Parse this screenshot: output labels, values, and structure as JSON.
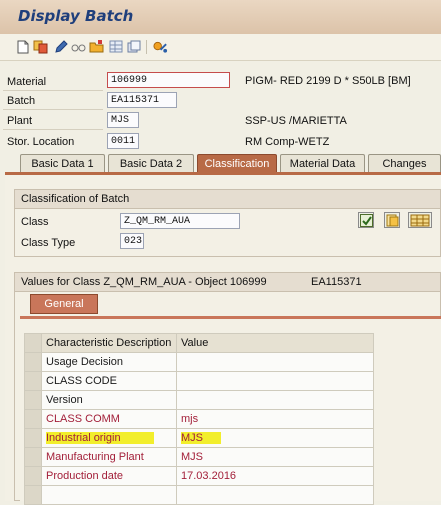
{
  "window": {
    "title": "Display Batch"
  },
  "toolbar": {
    "icons": [
      "new-document-icon",
      "copy-icon",
      "edit-pencil-icon",
      "glasses-icon",
      "folder-icon",
      "grid-icon",
      "layers-icon"
    ]
  },
  "header": {
    "material": {
      "label": "Material",
      "value": "106999",
      "description": "PIGM- RED 2199 D * S50LB [BM]"
    },
    "batch": {
      "label": "Batch",
      "value": "EA115371"
    },
    "plant": {
      "label": "Plant",
      "value": "MJS",
      "description": "SSP-US   /MARIETTA"
    },
    "stor_location": {
      "label": "Stor. Location",
      "value": "0011",
      "description": "RM Comp-WETZ"
    }
  },
  "tabs": [
    {
      "label": "Basic Data 1",
      "active": false
    },
    {
      "label": "Basic Data 2",
      "active": false
    },
    {
      "label": "Classification",
      "active": true
    },
    {
      "label": "Material Data",
      "active": false
    },
    {
      "label": "Changes",
      "active": false
    }
  ],
  "classification": {
    "group_title": "Classification of Batch",
    "class_label": "Class",
    "class_value": "Z_QM_RM_AUA",
    "class_type_label": "Class Type",
    "class_type_value": "023"
  },
  "values": {
    "title": "Values for Class Z_QM_RM_AUA - Object 106999",
    "object_batch": "EA115371",
    "subtab": "General",
    "columns": [
      "Characteristic Description",
      "Value"
    ],
    "rows": [
      {
        "desc": "Usage Decision",
        "value": "",
        "color": "black",
        "highlight": false
      },
      {
        "desc": "CLASS CODE",
        "value": "",
        "color": "black",
        "highlight": false
      },
      {
        "desc": "Version",
        "value": "",
        "color": "black",
        "highlight": false
      },
      {
        "desc": "CLASS COMM",
        "value": "mjs",
        "color": "red",
        "highlight": false
      },
      {
        "desc": "Industrial origin",
        "value": "MJS",
        "color": "red",
        "highlight": true
      },
      {
        "desc": "Manufacturing Plant",
        "value": "MJS",
        "color": "red",
        "highlight": false
      },
      {
        "desc": "Production date",
        "value": "17.03.2016",
        "color": "red",
        "highlight": false
      },
      {
        "desc": "",
        "value": "",
        "color": "black",
        "highlight": false
      }
    ]
  },
  "colors": {
    "accent": "#b86a46",
    "title": "#1f3f7c",
    "required_text": "#a3203a",
    "highlight": "#f2ee2c"
  }
}
